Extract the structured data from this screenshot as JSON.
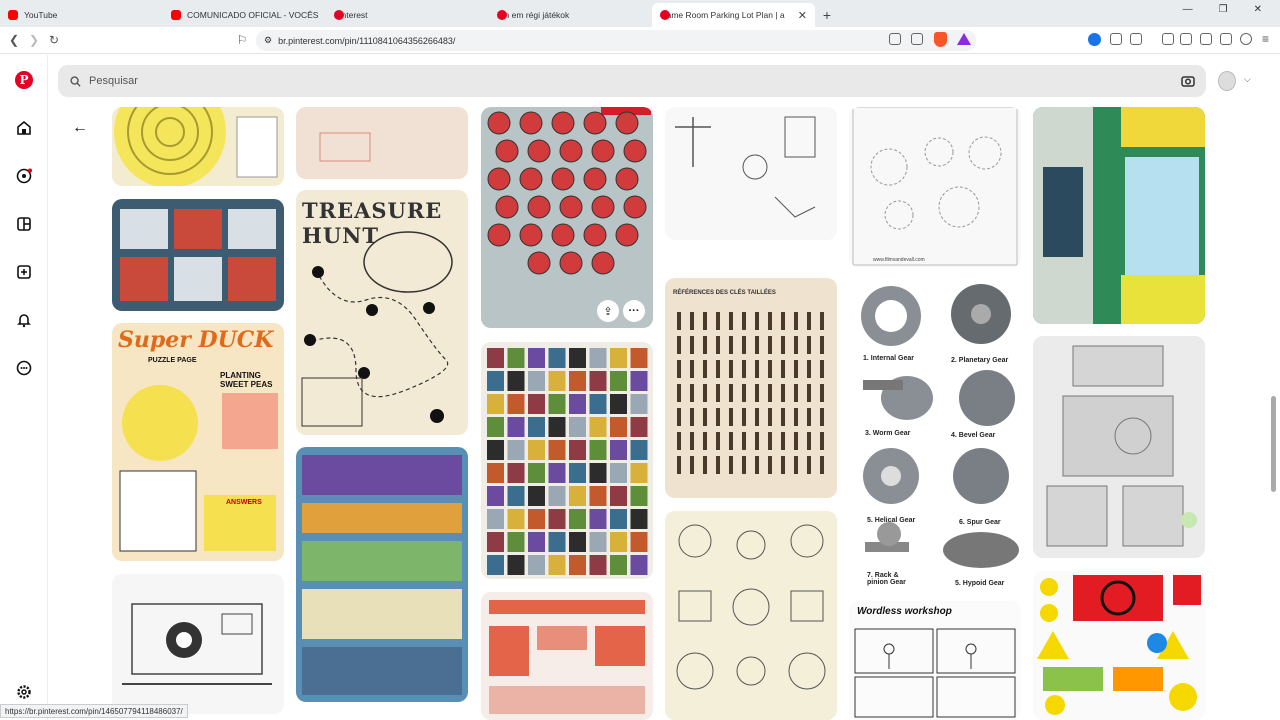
{
  "browser": {
    "tabs": [
      {
        "title": "YouTube",
        "icon": "youtube-icon"
      },
      {
        "title": "COMUNICADO OFICIAL - VOCÊS",
        "icon": "youtube-icon"
      },
      {
        "title": "Pinterest",
        "icon": "pinterest-icon"
      },
      {
        "title": "Pin em régi játékok",
        "icon": "pinterest-icon"
      },
      {
        "title": "Game Room Parking Lot Plan | a",
        "icon": "pinterest-icon"
      }
    ],
    "new_tab": "+",
    "url": "br.pinterest.com/pin/1110841064356266483/",
    "status_url": "https://br.pinterest.com/pin/146507794118486037/"
  },
  "search": {
    "placeholder": "Pesquisar"
  },
  "pins": {
    "treasure_title": "TREASURE HUNT",
    "duck_title": "Super DUCK",
    "duck_sub": "PUZZLE PAGE",
    "duck_side": "PLANTING SWEET PEAS",
    "duck_answers": "ANSWERS",
    "keys_title": "RÉFÉRENCES DES CLÉS TAILLÉES",
    "gears": [
      "1. Internal Gear",
      "2. Planetary Gear",
      "3. Worm Gear",
      "4. Bevel Gear",
      "5. Helical Gear",
      "6. Spur Gear",
      "7. Rack & pinion Gear",
      "5. Hypoid Gear"
    ],
    "gears_site": "www.filmvandevall.com",
    "wordless": "Wordless workshop"
  },
  "colors": {
    "brand": "#e60023"
  }
}
